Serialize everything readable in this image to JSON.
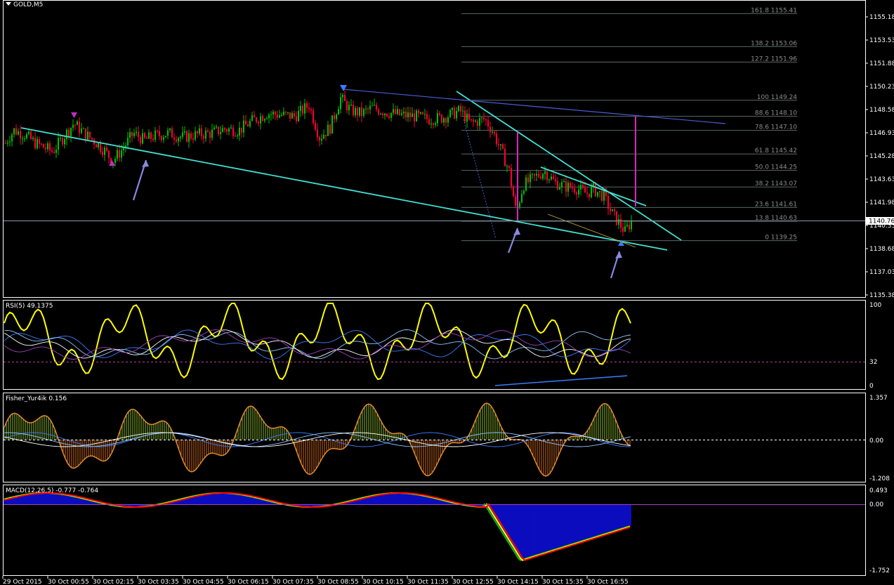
{
  "window": {
    "symbol_label": "GOLD,M5"
  },
  "colors": {
    "background": "#000000",
    "grid": "#ffffff",
    "bull_candle": "#00c000",
    "bear_candle": "#ff0033",
    "trendline": "#40e0d0",
    "channel": "#4a5cd6",
    "fib": "#5a6868",
    "magenta": "#e020c0",
    "arrow": "#8888dd",
    "rsi": "#ffff00",
    "rsi_ma": "#3a7cff",
    "fisher_up": "#8ab830",
    "fisher_down": "#d06a20",
    "macd_hist": "#1010ff",
    "macd_signal": "#ff0000"
  },
  "main_chart": {
    "price_axis": [
      "1155.18",
      "1153.53",
      "1151.88",
      "1150.23",
      "1148.58",
      "1146.93",
      "1145.28",
      "1143.63",
      "1141.98",
      "1140.33",
      "1138.68",
      "1137.03",
      "1135.38"
    ],
    "current_price": "1140.76",
    "fib_levels": [
      "161.8 1155.41",
      "138.2 1153.06",
      "127.2 1151.96",
      "100 1149.24",
      "88.6 1148.10",
      "78.6 1147.10",
      "61.8 1145.42",
      "50.0 1144.25",
      "38.2 1143.07",
      "23.6 1141.61",
      "13.8 1140.63",
      "0 1139.25"
    ]
  },
  "rsi": {
    "label": "RSI(5) 49.1375",
    "axis": [
      "100",
      "32",
      "0"
    ]
  },
  "fisher": {
    "label": "Fisher_Yur4ik 0.156",
    "axis": [
      "1.357",
      "0.00",
      "-1.208"
    ]
  },
  "macd": {
    "label": "MACD(12,26,5) -0.777 -0.764",
    "axis": [
      "0.493",
      "0.00",
      "-1.752"
    ]
  },
  "time_axis": [
    "29 Oct 2015",
    "30 Oct 00:55",
    "30 Oct 02:15",
    "30 Oct 03:35",
    "30 Oct 04:55",
    "30 Oct 06:15",
    "30 Oct 07:35",
    "30 Oct 08:55",
    "30 Oct 10:15",
    "30 Oct 11:35",
    "30 Oct 12:55",
    "30 Oct 14:15",
    "30 Oct 15:35",
    "30 Oct 16:55"
  ],
  "chart_data": {
    "type": "candlestick",
    "symbol": "GOLD",
    "timeframe": "M5",
    "price_range": [
      1135.38,
      1155.18
    ],
    "price_path": [
      [
        0,
        1145.3
      ],
      [
        10,
        1146.4
      ],
      [
        20,
        1147.1
      ],
      [
        35,
        1146.8
      ],
      [
        50,
        1146.2
      ],
      [
        75,
        1145.6
      ],
      [
        90,
        1146.6
      ],
      [
        105,
        1147.6
      ],
      [
        120,
        1146.9
      ],
      [
        135,
        1146.3
      ],
      [
        150,
        1145.6
      ],
      [
        160,
        1144.9
      ],
      [
        175,
        1145.8
      ],
      [
        190,
        1146.9
      ],
      [
        205,
        1146.4
      ],
      [
        220,
        1146.7
      ],
      [
        240,
        1146.9
      ],
      [
        260,
        1146.6
      ],
      [
        280,
        1146.8
      ],
      [
        300,
        1146.9
      ],
      [
        320,
        1147.2
      ],
      [
        340,
        1147.1
      ],
      [
        360,
        1147.8
      ],
      [
        380,
        1148.3
      ],
      [
        400,
        1148.2
      ],
      [
        420,
        1148.1
      ],
      [
        440,
        1148.9
      ],
      [
        455,
        1146.6
      ],
      [
        470,
        1147.3
      ],
      [
        485,
        1149.4
      ],
      [
        500,
        1148.5
      ],
      [
        515,
        1148.3
      ],
      [
        530,
        1148.7
      ],
      [
        550,
        1148.4
      ],
      [
        570,
        1148.2
      ],
      [
        590,
        1148.1
      ],
      [
        610,
        1147.9
      ],
      [
        630,
        1148.0
      ],
      [
        655,
        1148.5
      ],
      [
        670,
        1147.6
      ],
      [
        690,
        1147.9
      ],
      [
        700,
        1147.2
      ],
      [
        715,
        1145.5
      ],
      [
        725,
        1144.2
      ],
      [
        735,
        1141.2
      ],
      [
        745,
        1143.2
      ],
      [
        760,
        1143.7
      ],
      [
        775,
        1144.2
      ],
      [
        790,
        1143.4
      ],
      [
        805,
        1143.1
      ],
      [
        820,
        1143.0
      ],
      [
        835,
        1142.6
      ],
      [
        845,
        1142.9
      ],
      [
        860,
        1142.4
      ],
      [
        870,
        1141.3
      ],
      [
        880,
        1140.6
      ],
      [
        890,
        1139.9
      ],
      [
        900,
        1140.7
      ]
    ],
    "fib_retracement": [
      {
        "level": 161.8,
        "price": 1155.41
      },
      {
        "level": 138.2,
        "price": 1153.06
      },
      {
        "level": 127.2,
        "price": 1151.96
      },
      {
        "level": 100,
        "price": 1149.24
      },
      {
        "level": 88.6,
        "price": 1148.1
      },
      {
        "level": 78.6,
        "price": 1147.1
      },
      {
        "level": 61.8,
        "price": 1145.42
      },
      {
        "level": 50.0,
        "price": 1144.25
      },
      {
        "level": 38.2,
        "price": 1143.07
      },
      {
        "level": 23.6,
        "price": 1141.61
      },
      {
        "level": 13.8,
        "price": 1140.63
      },
      {
        "level": 0,
        "price": 1139.25
      }
    ],
    "indicators": [
      {
        "name": "RSI(5)",
        "value": 49.1375,
        "range": [
          0,
          100
        ],
        "level": 32
      },
      {
        "name": "Fisher_Yur4ik",
        "value": 0.156,
        "range": [
          -1.208,
          1.357
        ]
      },
      {
        "name": "MACD(12,26,5)",
        "main": -0.777,
        "signal": -0.764,
        "range": [
          -1.752,
          0.493
        ]
      }
    ]
  }
}
